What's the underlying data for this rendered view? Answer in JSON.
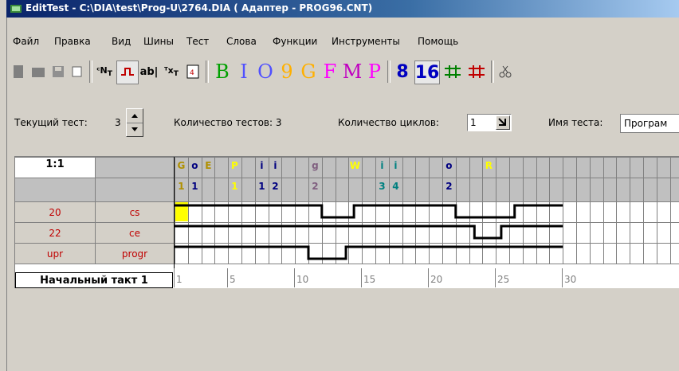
{
  "window": {
    "title": "EditTest - C:\\DIA\\test\\Prog-U\\2764.DIA ( Адаптер - PROG96.CNT)"
  },
  "menu": [
    "Файл",
    "Правка",
    "Вид",
    "Шины",
    "Тест",
    "Слова",
    "Функции",
    "Инструменты",
    "Помощь"
  ],
  "toolbar": {
    "letters": [
      {
        "label": "B",
        "color": "#00a000"
      },
      {
        "label": "I",
        "color": "#5050ff"
      },
      {
        "label": "O",
        "color": "#5050ff"
      },
      {
        "label": "9",
        "color": "#ffb000"
      },
      {
        "label": "G",
        "color": "#ffb000"
      },
      {
        "label": "F",
        "color": "#ff00ff"
      },
      {
        "label": "M",
        "color": "#c000c0"
      },
      {
        "label": "P",
        "color": "#ff00ff"
      }
    ],
    "num8": "8",
    "num16": "16",
    "text_tool": "ab|"
  },
  "params": {
    "current_test_label": "Текущий тест:",
    "current_test_value": "3",
    "test_count_label": "Количество тестов: 3",
    "cycles_label": "Количество циклов:",
    "cycles_value": "1",
    "test_name_label": "Имя теста:",
    "test_name_value": "Програм"
  },
  "grid": {
    "corner_label": "1:1",
    "rows": [
      {
        "pin": "20",
        "name": "cs"
      },
      {
        "pin": "22",
        "name": "ce"
      },
      {
        "pin": "upr",
        "name": "progr"
      }
    ],
    "start_label": "Начальный такт 1",
    "ruler": [
      "1",
      "5",
      "10",
      "15",
      "20",
      "25",
      "30"
    ],
    "headers": [
      {
        "col": 1,
        "top": "G",
        "bottom": "1",
        "color": "#b09000"
      },
      {
        "col": 2,
        "top": "o",
        "bottom": "1",
        "color": "#000080"
      },
      {
        "col": 3,
        "top": "E",
        "bottom": "",
        "color": "#b09000"
      },
      {
        "col": 5,
        "top": "P",
        "bottom": "1",
        "color": "#ffff00"
      },
      {
        "col": 7,
        "top": "i",
        "bottom": "1",
        "color": "#000080"
      },
      {
        "col": 8,
        "top": "i",
        "bottom": "2",
        "color": "#000080"
      },
      {
        "col": 11,
        "top": "g",
        "bottom": "2",
        "color": "#806080"
      },
      {
        "col": 14,
        "top": "W",
        "bottom": "",
        "color": "#ffff00"
      },
      {
        "col": 16,
        "top": "i",
        "bottom": "3",
        "color": "#008080"
      },
      {
        "col": 17,
        "top": "i",
        "bottom": "4",
        "color": "#008080"
      },
      {
        "col": 21,
        "top": "o",
        "bottom": "2",
        "color": "#000080"
      },
      {
        "col": 24,
        "top": "R",
        "bottom": "",
        "color": "#ffff00"
      }
    ],
    "waves": [
      {
        "low_from": 10,
        "low_to": 12
      },
      {
        "low_from": 19,
        "low_to": 21
      },
      {
        "low_from": 8,
        "low_to": 11
      }
    ],
    "wave_extra": [
      {
        "row": 0,
        "low_from": 18,
        "low_to": 22
      }
    ]
  },
  "colors": {
    "signal_label": "#c00000",
    "cursor": "#ffff00"
  }
}
